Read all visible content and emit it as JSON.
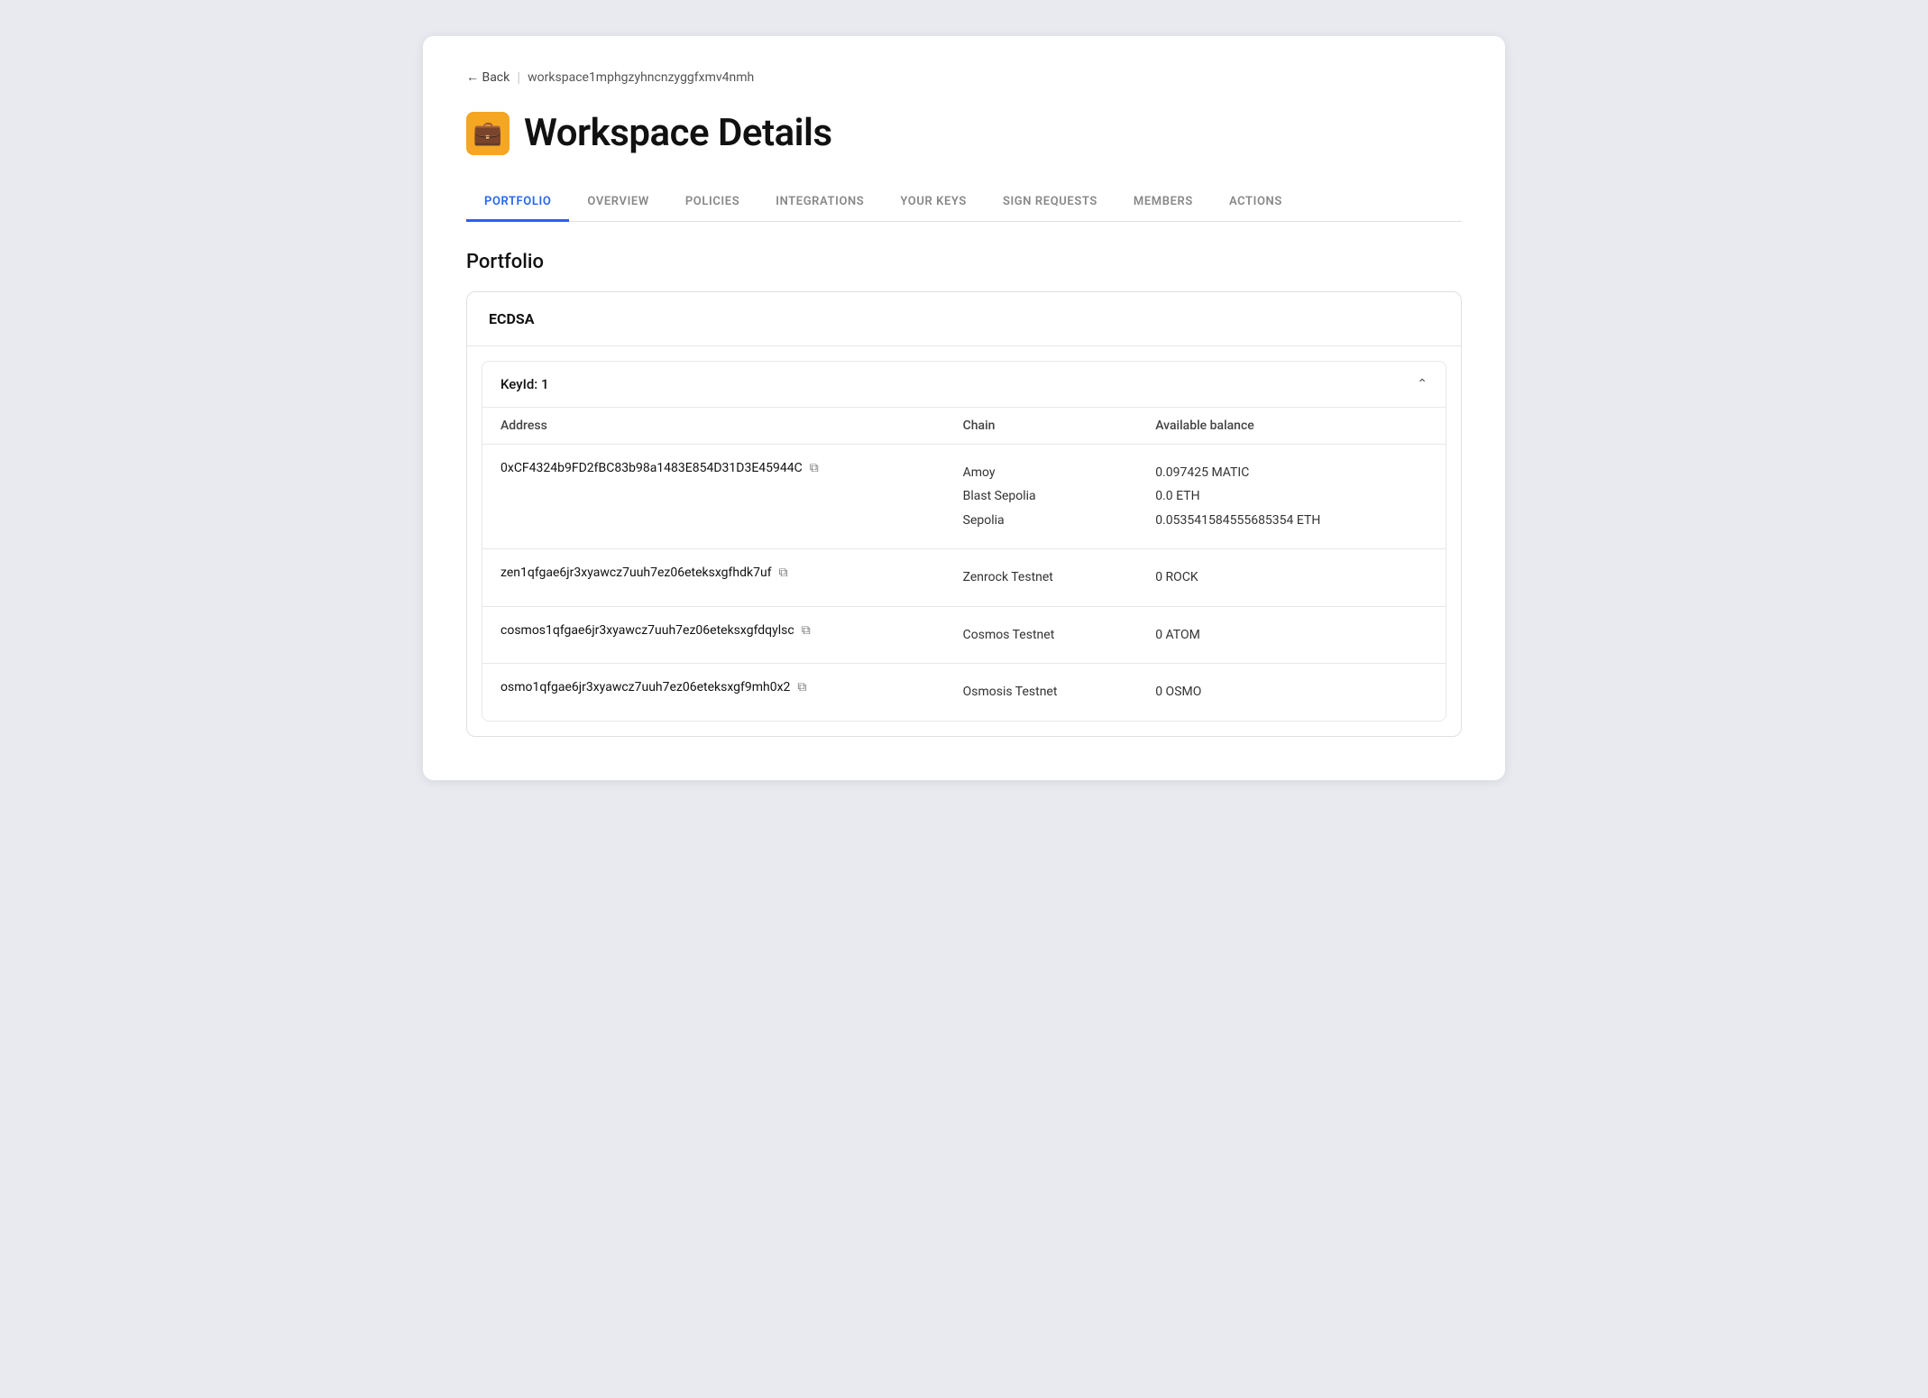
{
  "breadcrumb": {
    "back_label": "← Back",
    "path": "workspace1mphgzyhncnzyggfxmv4nmh"
  },
  "header": {
    "icon": "🟡",
    "title": "Workspace Details"
  },
  "tabs": [
    {
      "id": "portfolio",
      "label": "PORTFOLIO",
      "active": true
    },
    {
      "id": "overview",
      "label": "OVERVIEW",
      "active": false
    },
    {
      "id": "policies",
      "label": "POLICIES",
      "active": false
    },
    {
      "id": "integrations",
      "label": "INTEGRATIONS",
      "active": false
    },
    {
      "id": "your-keys",
      "label": "YOUR KEYS",
      "active": false
    },
    {
      "id": "sign-requests",
      "label": "SIGN REQUESTS",
      "active": false
    },
    {
      "id": "members",
      "label": "MEMBERS",
      "active": false
    },
    {
      "id": "actions",
      "label": "ACTIONS",
      "active": false
    }
  ],
  "section": {
    "title": "Portfolio"
  },
  "portfolio": {
    "card_title": "ECDSA",
    "key_label": "KeyId: 1",
    "table": {
      "col_address": "Address",
      "col_chain": "Chain",
      "col_balance": "Available balance",
      "rows": [
        {
          "address": "0xCF4324b9FD2fBC83b98a1483E854D31D3E45944C",
          "chains": [
            "Amoy",
            "Blast Sepolia",
            "Sepolia"
          ],
          "balances": [
            "0.097425 MATIC",
            "0.0 ETH",
            "0.053541584555685354 ETH"
          ]
        },
        {
          "address": "zen1qfgae6jr3xyawcz7uuh7ez06eteksxgfhdk7uf",
          "chains": [
            "Zenrock Testnet"
          ],
          "balances": [
            "0 ROCK"
          ]
        },
        {
          "address": "cosmos1qfgae6jr3xyawcz7uuh7ez06eteksxgfdqylsc",
          "chains": [
            "Cosmos Testnet"
          ],
          "balances": [
            "0 ATOM"
          ]
        },
        {
          "address": "osmo1qfgae6jr3xyawcz7uuh7ez06eteksxgf9mh0x2",
          "chains": [
            "Osmosis Testnet"
          ],
          "balances": [
            "0 OSMO"
          ]
        }
      ]
    }
  }
}
